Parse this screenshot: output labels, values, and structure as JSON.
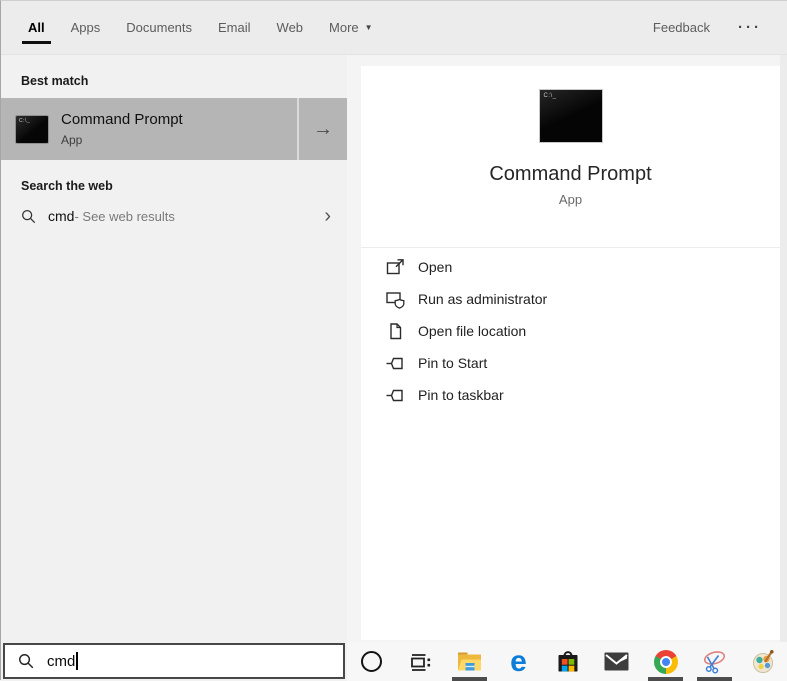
{
  "header": {
    "tabs": [
      {
        "label": "All",
        "active": true
      },
      {
        "label": "Apps",
        "active": false
      },
      {
        "label": "Documents",
        "active": false
      },
      {
        "label": "Email",
        "active": false
      },
      {
        "label": "Web",
        "active": false
      },
      {
        "label": "More",
        "active": false
      }
    ],
    "more_arrow": "▼",
    "feedback_label": "Feedback",
    "overflow_dots": "···"
  },
  "left_panel": {
    "best_match_header": "Best match",
    "best_match": {
      "title": "Command Prompt",
      "subtitle": "App",
      "icon_text": "C:\\_",
      "expand_arrow": "→"
    },
    "web_section_header": "Search the web",
    "web_result": {
      "query": "cmd",
      "suffix": " - See web results",
      "chevron": "›"
    }
  },
  "preview_panel": {
    "icon_text": "C:\\_",
    "app_title": "Command Prompt",
    "app_subtitle": "App",
    "actions": [
      {
        "label": "Open"
      },
      {
        "label": "Run as administrator"
      },
      {
        "label": "Open file location"
      },
      {
        "label": "Pin to Start"
      },
      {
        "label": "Pin to taskbar"
      }
    ]
  },
  "search_bar": {
    "value": "cmd"
  },
  "taskbar": {
    "icons": [
      "cortana",
      "task-view",
      "file-explorer",
      "edge",
      "store",
      "mail",
      "chrome",
      "snipping-tool",
      "paint-3d"
    ],
    "running": [
      "file-explorer",
      "chrome",
      "snipping-tool"
    ]
  },
  "colors": {
    "highlight_gray": "#b5b5b5",
    "panel_bg": "#f1f1f1",
    "card_bg": "#ffffff",
    "accent_blue": "#0c7dd9"
  }
}
